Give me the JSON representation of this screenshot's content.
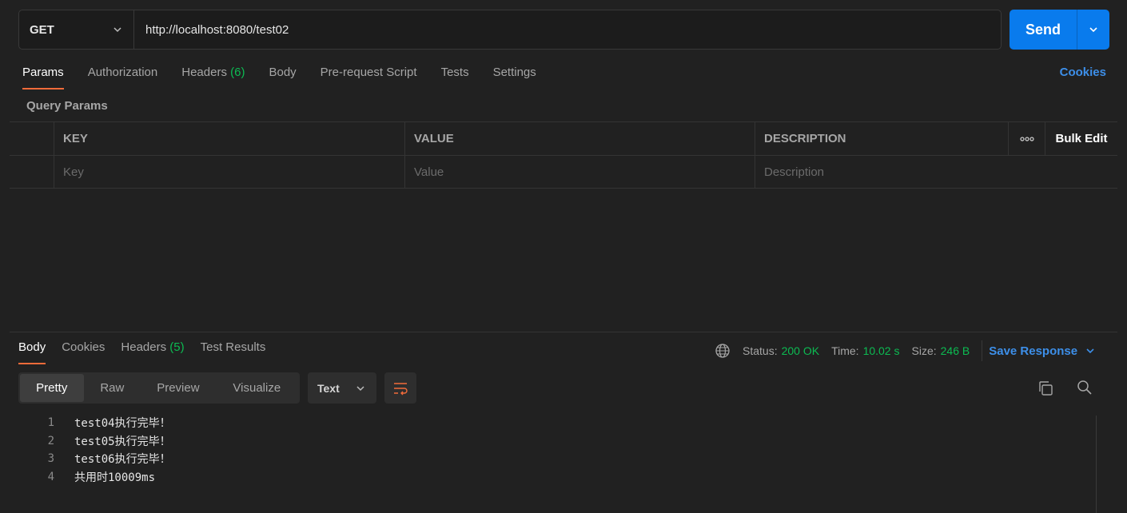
{
  "request": {
    "method": "GET",
    "url": "http://localhost:8080/test02",
    "send_label": "Send"
  },
  "request_tabs": [
    {
      "label": "Params",
      "active": true
    },
    {
      "label": "Authorization"
    },
    {
      "label": "Headers",
      "badge": "(6)"
    },
    {
      "label": "Body"
    },
    {
      "label": "Pre-request Script"
    },
    {
      "label": "Tests"
    },
    {
      "label": "Settings"
    }
  ],
  "cookies_link": "Cookies",
  "query_params": {
    "title": "Query Params",
    "columns": [
      "KEY",
      "VALUE",
      "DESCRIPTION"
    ],
    "bulk_edit": "Bulk Edit",
    "more": "ooo",
    "placeholders": {
      "key": "Key",
      "value": "Value",
      "description": "Description"
    }
  },
  "response_tabs": [
    {
      "label": "Body",
      "active": true
    },
    {
      "label": "Cookies"
    },
    {
      "label": "Headers",
      "badge": "(5)"
    },
    {
      "label": "Test Results"
    }
  ],
  "response_meta": {
    "status_label": "Status:",
    "status_value": "200 OK",
    "time_label": "Time:",
    "time_value": "10.02 s",
    "size_label": "Size:",
    "size_value": "246 B",
    "save_response": "Save Response"
  },
  "view_modes": [
    "Pretty",
    "Raw",
    "Preview",
    "Visualize"
  ],
  "format": "Text",
  "code_lines": [
    {
      "n": "1",
      "text": "test04执行完毕！"
    },
    {
      "n": "2",
      "text": "test05执行完毕！"
    },
    {
      "n": "3",
      "text": "test06执行完毕！"
    },
    {
      "n": "4",
      "text": "共用时10009ms"
    }
  ],
  "colors": {
    "accent": "#097bed",
    "tab_underline": "#f26b3a",
    "success": "#0cbb52",
    "link": "#3d8fe9"
  }
}
